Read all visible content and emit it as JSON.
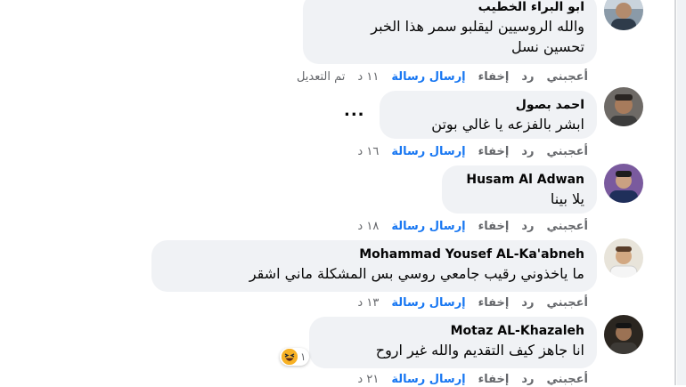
{
  "comments": [
    {
      "author": "ابو البراء الخطيب",
      "lines": [
        "والله الروسيين ليقلبو سمر هذا الخبر",
        "تحسين نسل"
      ],
      "actions": {
        "like": "أعجبني",
        "reply": "رد",
        "hide": "إخفاء",
        "send": "إرسال رسالة",
        "time": "١١ د",
        "edited": "تم التعديل"
      }
    },
    {
      "author": "احمد بصول",
      "lines": [
        "ابشر بالفزعه يا غالي بوتن"
      ],
      "more": "...",
      "actions": {
        "like": "أعجبني",
        "reply": "رد",
        "hide": "إخفاء",
        "send": "إرسال رسالة",
        "time": "١٦ د"
      }
    },
    {
      "author": "Husam Al Adwan",
      "lines": [
        "يلا بينا"
      ],
      "actions": {
        "like": "أعجبني",
        "reply": "رد",
        "hide": "إخفاء",
        "send": "إرسال رسالة",
        "time": "١٨ د"
      }
    },
    {
      "author": "Mohammad Yousef AL-Ka'abneh",
      "lines": [
        "ما ياخذوني رقيب جامعي روسي بس المشكلة ماني اشقر"
      ],
      "actions": {
        "like": "أعجبني",
        "reply": "رد",
        "hide": "إخفاء",
        "send": "إرسال رسالة",
        "time": "١٣ د"
      }
    },
    {
      "author": "Motaz AL-Khazaleh",
      "lines": [
        "انا جاهز كيف التقديم والله غير اروح"
      ],
      "reaction": {
        "icon": "haha-emoji-icon",
        "count": "١"
      },
      "actions": {
        "like": "أعجبني",
        "reply": "رد",
        "hide": "إخفاء",
        "send": "إرسال رسالة",
        "time": "٢١ د"
      }
    }
  ],
  "colors": {
    "bubble": "#f0f2f5",
    "link": "#1877f2",
    "meta": "#65676b",
    "text": "#050505"
  }
}
